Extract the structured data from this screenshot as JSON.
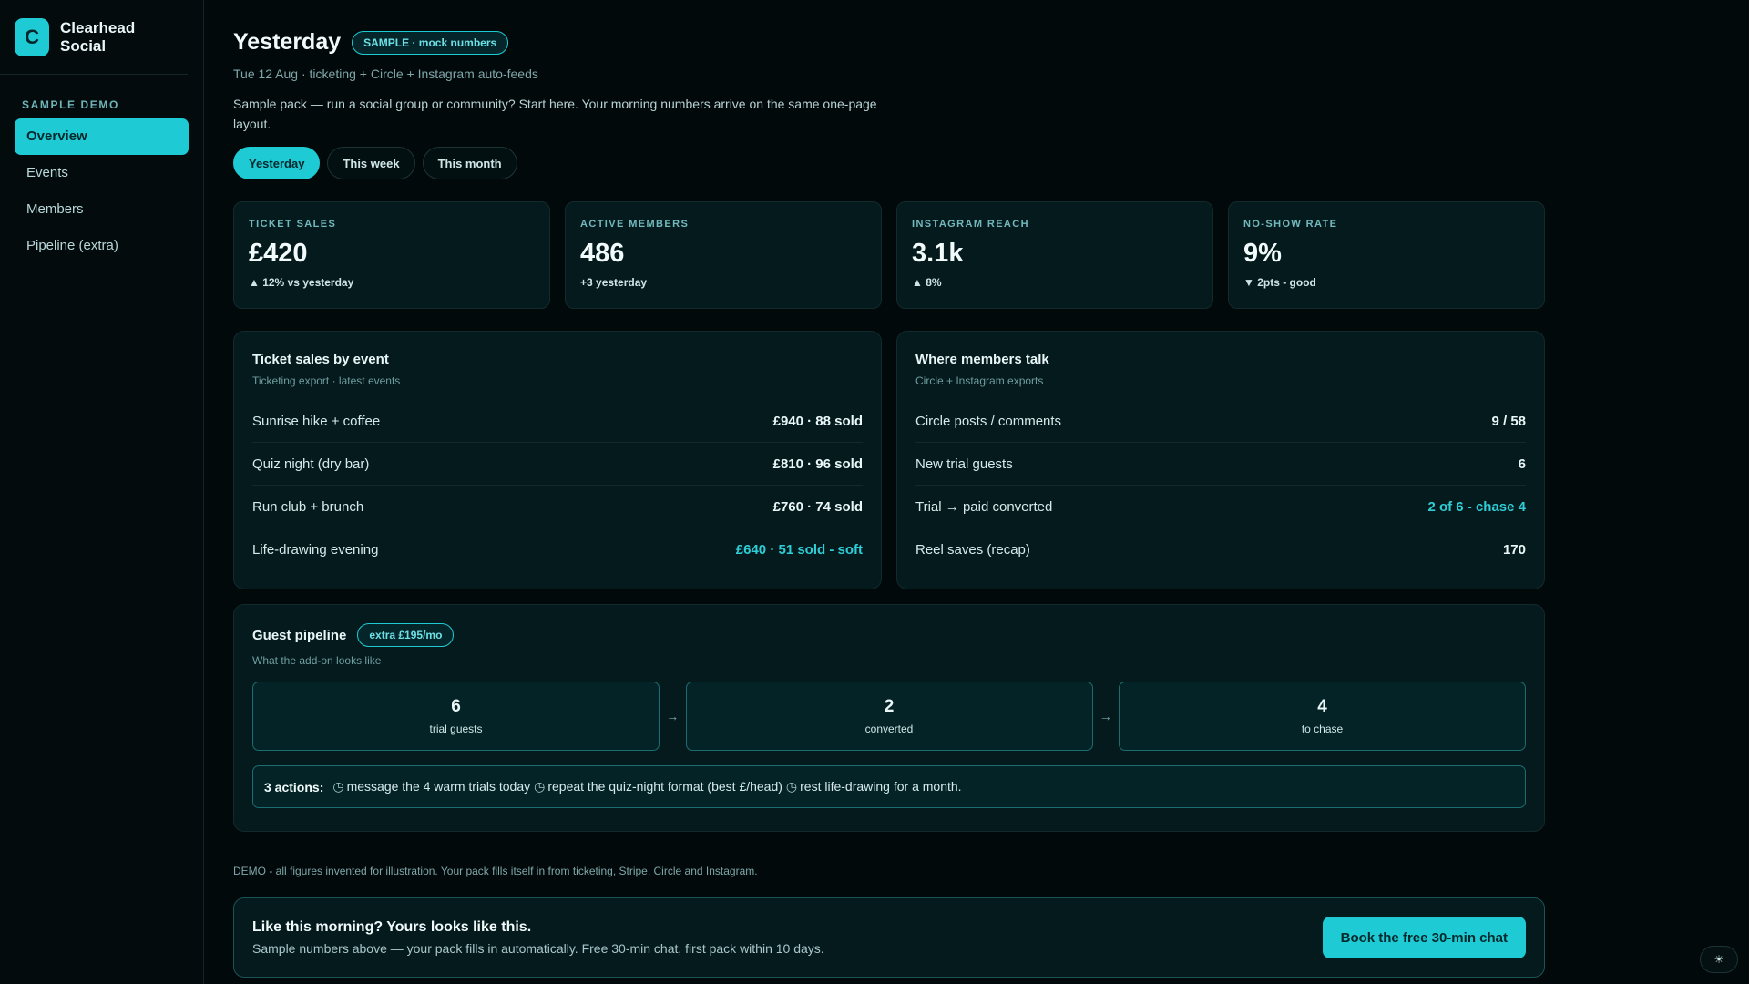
{
  "brand": {
    "logo_letter": "C",
    "name": "Clearhead Social"
  },
  "sidebar": {
    "heading": "SAMPLE DEMO",
    "items": [
      {
        "label": "Overview",
        "active": true
      },
      {
        "label": "Events",
        "active": false
      },
      {
        "label": "Members",
        "active": false
      },
      {
        "label": "Pipeline (extra)",
        "active": false
      }
    ]
  },
  "header": {
    "title": "Yesterday",
    "badge": "SAMPLE · mock numbers",
    "subtitle": "Tue 12 Aug · ticketing + Circle + Instagram auto-feeds",
    "intro": "Sample pack — run a social group or community? Start here. Your morning numbers arrive on the same one-page layout.",
    "tabs": [
      {
        "label": "Yesterday",
        "active": true
      },
      {
        "label": "This week",
        "active": false
      },
      {
        "label": "This month",
        "active": false
      }
    ]
  },
  "kpis": [
    {
      "label": "TICKET SALES",
      "value": "£420",
      "delta": "▲ 12% vs yesterday"
    },
    {
      "label": "ACTIVE MEMBERS",
      "value": "486",
      "delta": "+3 yesterday"
    },
    {
      "label": "INSTAGRAM REACH",
      "value": "3.1k",
      "delta": "▲ 8%"
    },
    {
      "label": "NO-SHOW RATE",
      "value": "9%",
      "delta": "▼ 2pts - good"
    }
  ],
  "ticket_card": {
    "title": "Ticket sales by event",
    "subtitle": "Ticketing export · latest events",
    "rows": [
      {
        "label": "Sunrise hike + coffee",
        "value": "£940 · 88 sold"
      },
      {
        "label": "Quiz night (dry bar)",
        "value": "£810 · 96 sold"
      },
      {
        "label": "Run club + brunch",
        "value": "£760 · 74 sold"
      },
      {
        "label": "Life-drawing evening",
        "value": "£640 · 51 sold - soft"
      }
    ]
  },
  "talk_card": {
    "title": "Where members talk",
    "subtitle": "Circle + Instagram exports",
    "rows": [
      {
        "label": "Circle posts / comments",
        "value": "9 / 58"
      },
      {
        "label": "New trial guests",
        "value": "6"
      },
      {
        "label": "Trial → paid converted",
        "value": "2 of 6 - chase 4"
      },
      {
        "label": "Reel saves (recap)",
        "value": "170"
      }
    ]
  },
  "pipeline": {
    "title": "Guest pipeline",
    "badge": "extra £195/mo",
    "subtitle": "What the add-on looks like",
    "stages": [
      {
        "num": "6",
        "label": "trial guests"
      },
      {
        "num": "2",
        "label": "converted"
      },
      {
        "num": "4",
        "label": "to chase"
      }
    ],
    "actions_lead": "3 actions:",
    "actions": [
      "message the 4 warm trials today",
      "repeat the quiz-night format (best £/head)",
      "rest life-drawing for a month."
    ]
  },
  "demo_note": "DEMO - all figures invented for illustration. Your pack fills itself in from ticketing, Stripe, Circle and Instagram.",
  "cta": {
    "title": "Like this morning? Yours looks like this.",
    "subtitle": "Sample numbers above — your pack fills in automatically. Free 30-min chat, first pack within 10 days.",
    "button": "Book the free 30-min chat"
  },
  "colors": {
    "accent": "#1ecad3",
    "background": "#02090b",
    "card": "#051a1d"
  },
  "icons": {
    "theme_toggle": "sun-icon",
    "action_bullet": "clock-icon"
  }
}
